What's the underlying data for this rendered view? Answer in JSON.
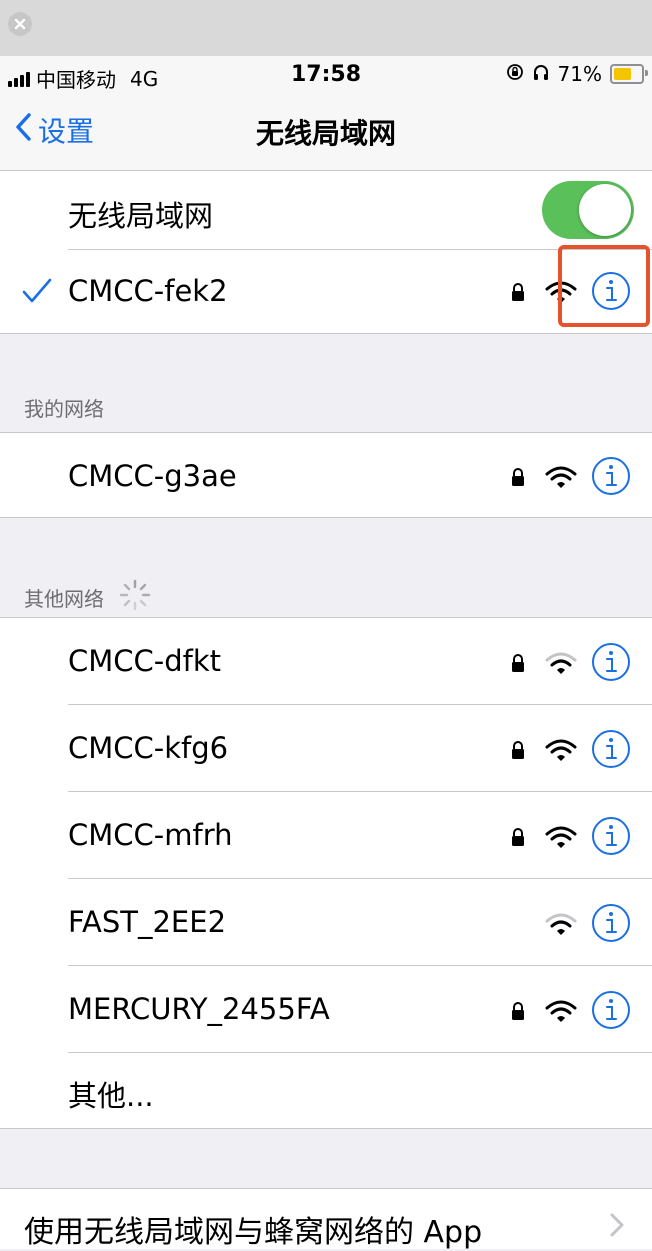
{
  "colors": {
    "accent": "#1a6fe3",
    "toggle_on": "#5ac05a",
    "battery_fill": "#f5c400",
    "highlight": "#e5532d"
  },
  "status_bar": {
    "carrier": "中国移动",
    "network": "4G",
    "time": "17:58",
    "battery": "71%",
    "battery_level": 0.71
  },
  "nav": {
    "back_label": "设置",
    "title": "无线局域网"
  },
  "wifi_toggle": {
    "label": "无线局域网",
    "on": true
  },
  "connected": {
    "ssid": "CMCC-fek2",
    "locked": true
  },
  "my_networks": {
    "header": "我的网络",
    "items": [
      {
        "ssid": "CMCC-g3ae",
        "locked": true
      }
    ]
  },
  "other_networks": {
    "header": "其他网络",
    "items": [
      {
        "ssid": "CMCC-dfkt",
        "locked": true
      },
      {
        "ssid": "CMCC-kfg6",
        "locked": true
      },
      {
        "ssid": "CMCC-mfrh",
        "locked": true
      },
      {
        "ssid": "FAST_2EE2",
        "locked": false
      },
      {
        "ssid": "MERCURY_2455FA",
        "locked": true
      }
    ],
    "other_label": "其他..."
  },
  "bottom_text": "使用无线局域网与蜂窝网络的 App"
}
